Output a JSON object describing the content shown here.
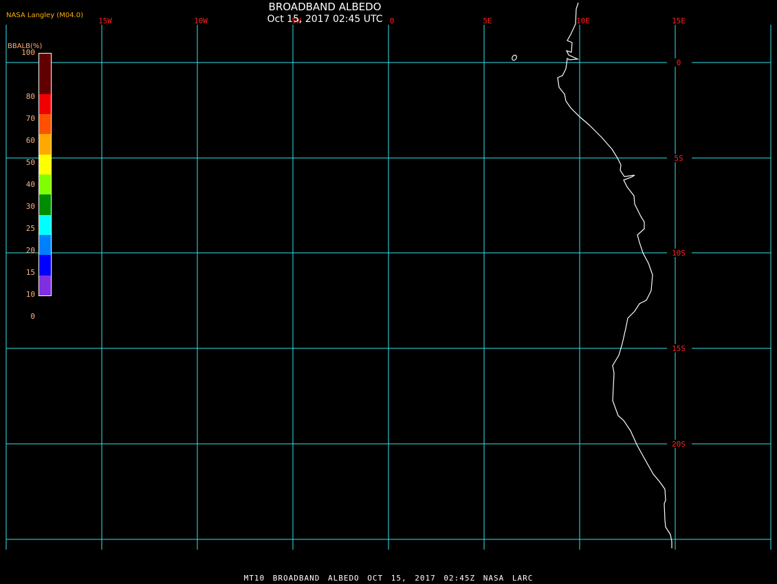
{
  "header": {
    "title": "BROADBAND ALBEDO",
    "subtitle": "Oct 15, 2017 02:45 UTC",
    "credit": "NASA Langley (M04.0)"
  },
  "legend": {
    "title": "BBALB(%)",
    "labels": [
      "100",
      "80",
      "70",
      "60",
      "50",
      "40",
      "30",
      "25",
      "20",
      "15",
      "10",
      "0"
    ],
    "colors": [
      "#600000",
      "#600000",
      "#f00000",
      "#ff5000",
      "#ffa800",
      "#ffff00",
      "#80ff00",
      "#008c00",
      "#00ffff",
      "#0080ff",
      "#0000ff",
      "#8030e0"
    ]
  },
  "map": {
    "longitude_labels": [
      "15W",
      "10W",
      "5W",
      "0",
      "5E",
      "10E",
      "15E"
    ],
    "latitude_labels": [
      "0",
      "5S",
      "10S",
      "15S",
      "20S"
    ],
    "grid_color": "#33e6ee",
    "label_color": "#ff2020",
    "coastline_color": "#ffffff"
  },
  "footer": {
    "text": "MT10  BROADBAND ALBEDO   OCT 15, 2017 02:45Z   NASA LARC"
  }
}
